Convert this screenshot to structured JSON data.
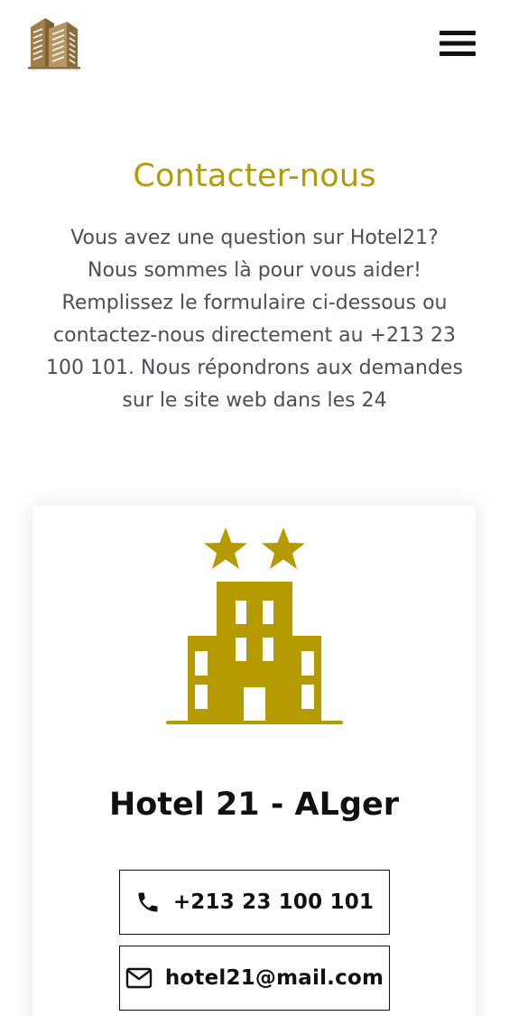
{
  "header": {
    "logo_icon": "building-logo-icon",
    "menu_icon": "hamburger-menu-icon"
  },
  "contact": {
    "title": "Contacter-nous",
    "intro": "Vous avez une question sur Hotel21? Nous sommes là pour vous aider! Remplissez le formulaire ci-dessous ou contactez-nous directement au +213 23 100 101. Nous répondrons aux demandes sur le site web dans les 24"
  },
  "card": {
    "icon": "two-star-hotel-icon",
    "hotel_name": "Hotel 21 - ALger",
    "phone_icon": "phone-icon",
    "phone": "+213 23 100 101",
    "email_icon": "mail-icon",
    "email": "hotel21@mail.com"
  },
  "colors": {
    "accent": "#b59a00",
    "logo_brown": "#9a7a47",
    "body_text": "#4a4f58"
  }
}
